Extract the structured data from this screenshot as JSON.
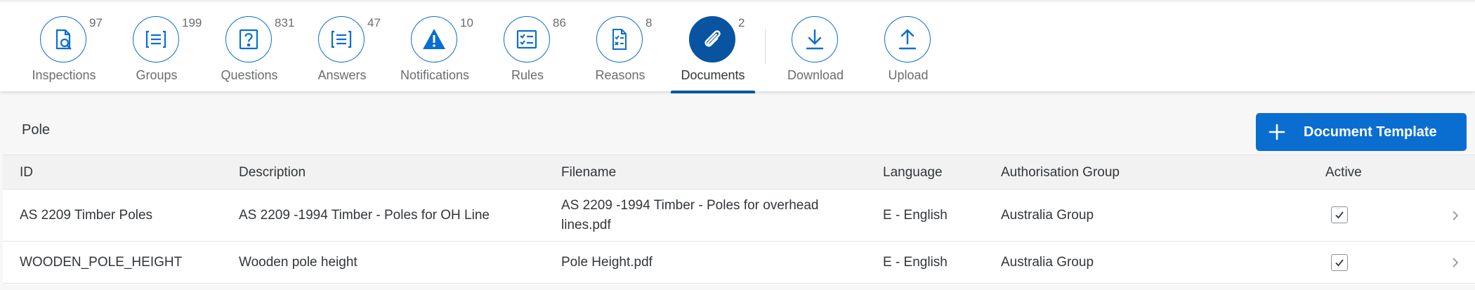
{
  "tabs": [
    {
      "label": "Inspections",
      "count": "97",
      "icon": "inspection-search-icon"
    },
    {
      "label": "Groups",
      "count": "199",
      "icon": "list-icon"
    },
    {
      "label": "Questions",
      "count": "831",
      "icon": "question-icon"
    },
    {
      "label": "Answers",
      "count": "47",
      "icon": "list-icon"
    },
    {
      "label": "Notifications",
      "count": "10",
      "icon": "warning-icon"
    },
    {
      "label": "Rules",
      "count": "86",
      "icon": "checklist-icon"
    },
    {
      "label": "Reasons",
      "count": "8",
      "icon": "document-checklist-icon"
    },
    {
      "label": "Documents",
      "count": "2",
      "icon": "paperclip-icon",
      "selected": true
    },
    {
      "label": "Download",
      "count": "",
      "icon": "download-icon"
    },
    {
      "label": "Upload",
      "count": "",
      "icon": "upload-icon"
    }
  ],
  "panel": {
    "title": "Pole",
    "add_button_label": "Document Template"
  },
  "table": {
    "columns": [
      "ID",
      "Description",
      "Filename",
      "Language",
      "Authorisation Group",
      "Active"
    ],
    "rows": [
      {
        "id": "AS 2209 Timber Poles",
        "description": "AS 2209 -1994 Timber - Poles for OH Line",
        "filename_line1": "AS 2209 -1994 Timber - Poles for overhead",
        "filename_line2": "lines.pdf",
        "language": "E - English",
        "auth_group": "Australia Group",
        "active": true
      },
      {
        "id": "WOODEN_POLE_HEIGHT",
        "description": "Wooden pole height",
        "filename_line1": "Pole Height.pdf",
        "filename_line2": "",
        "language": "E - English",
        "auth_group": "Australia Group",
        "active": true
      }
    ]
  },
  "colors": {
    "accent": "#0a6ed1",
    "selected": "#0854a0",
    "text": "#32363a",
    "muted": "#6a6d70"
  }
}
